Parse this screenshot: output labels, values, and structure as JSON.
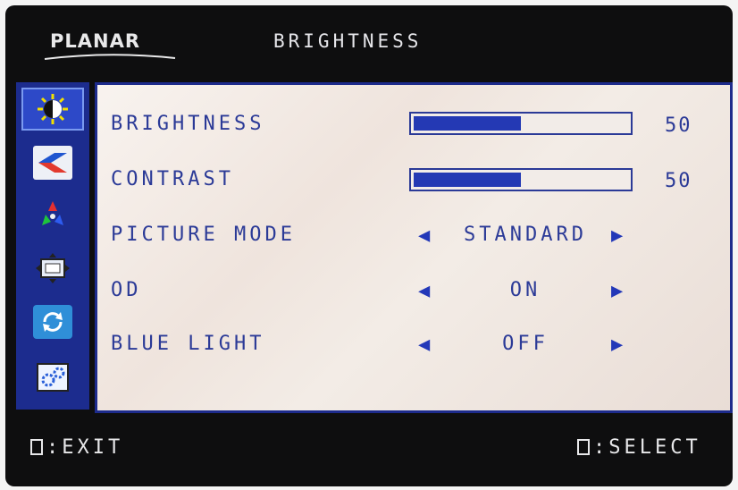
{
  "header": {
    "brand": "PLANAR",
    "title": "BRIGHTNESS"
  },
  "sidebar": {
    "items": [
      {
        "icon": "brightness-contrast-icon",
        "active": true
      },
      {
        "icon": "input-source-icon",
        "active": false
      },
      {
        "icon": "color-icon",
        "active": false
      },
      {
        "icon": "display-position-icon",
        "active": false
      },
      {
        "icon": "reset-icon",
        "active": false
      },
      {
        "icon": "setup-icon",
        "active": false
      }
    ]
  },
  "menu": {
    "brightness": {
      "label": "BRIGHTNESS",
      "value": "50",
      "level_percent": 50
    },
    "contrast": {
      "label": "CONTRAST",
      "value": "50",
      "level_percent": 50
    },
    "picture_mode": {
      "label": "PICTURE MODE",
      "value": "STANDARD"
    },
    "od": {
      "label": "OD",
      "value": "ON"
    },
    "blue_light": {
      "label": "BLUE LIGHT",
      "value": "OFF"
    }
  },
  "footer": {
    "exit": ":EXIT",
    "select": ":SELECT"
  },
  "colors": {
    "bezel": "#0e0e0f",
    "accent_blue": "#1c2c8e",
    "text_blue": "#2b3a97",
    "bar_fill": "#2439b4"
  }
}
